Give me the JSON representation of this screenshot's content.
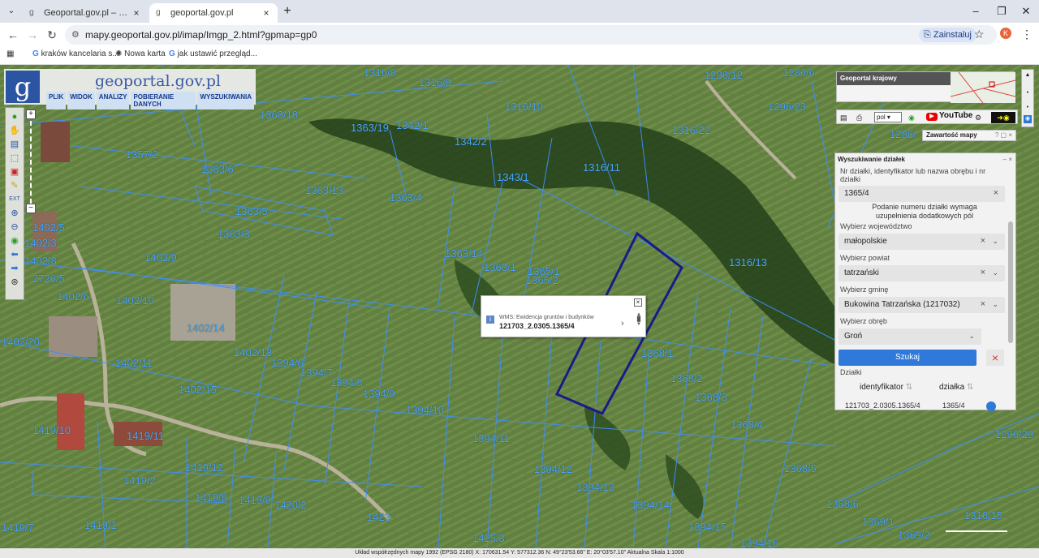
{
  "browser": {
    "tabs": [
      {
        "title": "Geoportal.gov.pl – Geoportal In",
        "active": false
      },
      {
        "title": "geoportal.gov.pl",
        "active": true
      }
    ],
    "url": "mapy.geoportal.gov.pl/imap/Imgp_2.html?gpmap=gp0",
    "install_label": "Zainstaluj",
    "profile_initial": "K",
    "bookmarks": [
      "kraków kancelaria s...",
      "Nowa karta",
      "jak ustawić przegląd..."
    ]
  },
  "app": {
    "logo_letter": "g",
    "logo_text": "geoportal.gov.pl",
    "menu": [
      "PLIK",
      "WIDOK",
      "ANALIZY",
      "POBIERANIE DANYCH",
      "WYSZUKIWANIA"
    ]
  },
  "overview": {
    "title": "Geoportal krajowy"
  },
  "toolbar2": {
    "lang": "pol",
    "youtube": "YouTube"
  },
  "content_panel": {
    "title": "Zawartość mapy"
  },
  "search_panel": {
    "title": "Wyszukiwanie działek",
    "query_label": "Nr działki, identyfikator lub nazwa obrębu i nr działki",
    "query_value": "1365/4",
    "note": "Podanie numeru działki wymaga uzupełnienia dodatkowych pól",
    "voivodeship_label": "Wybierz województwo",
    "voivodeship_value": "małopolskie",
    "county_label": "Wybierz powiat",
    "county_value": "tatrzański",
    "commune_label": "Wybierz gminę",
    "commune_value": "Bukowina Tatrzańska (1217032)",
    "precinct_label": "Wybierz obręb",
    "precinct_value": "Groń",
    "search_button": "Szukaj",
    "results_label": "Działki",
    "col_id": "identyfikator",
    "col_parcel": "działka",
    "row_id": "121703_2.0305.1365/4",
    "row_parcel": "1365/4"
  },
  "popup": {
    "layer": "WMS: Ewidencja gruntów i budynków",
    "id": "121703_2.0305.1365/4"
  },
  "statusbar": {
    "text": "Układ współrzędnych mapy 1992 (EPSG 2180)   X: 170631.54 Y: 577312.36   N: 49°23'53.66\" E: 20°03'57.10\"   Aktualna Skala 1:1000"
  },
  "parcels": [
    "1316/8",
    "1316/9",
    "1296/12",
    "1286/6",
    "1316/10",
    "1363/18",
    "1363/19",
    "1342/1",
    "1296/23",
    "1316/22",
    "1286/",
    "1342/2",
    "1357/2",
    "1363/6",
    "1343/1",
    "1316/11",
    "1363/13",
    "1363/4",
    "1363/5",
    "1363/3",
    "1402/9",
    "1363/14",
    "1363/1",
    "1365/1",
    "1365/2",
    "1316/13",
    "1402/10",
    "1402/14",
    "1402/13",
    "1394/6",
    "1394/7",
    "1394/8",
    "1394/9",
    "1368/1",
    "1402/11",
    "1402/15",
    "1394/10",
    "1368/2",
    "1368/3",
    "1368/4",
    "1394/11",
    "1419/10",
    "1419/11",
    "1419/12",
    "1419/2",
    "1394/12",
    "1394/13",
    "1419/8",
    "1419/9",
    "1420/2",
    "1394/14",
    "1368/5",
    "1296/29",
    "1368/6",
    "1423",
    "1369/1",
    "1316/15",
    "1419/7",
    "1419/1",
    "1425/3",
    "1394/15",
    "1369/2",
    "1394/16",
    "1402/20",
    "1402/6",
    "1402/8",
    "1402/5",
    "2726/5",
    "1402/3"
  ]
}
